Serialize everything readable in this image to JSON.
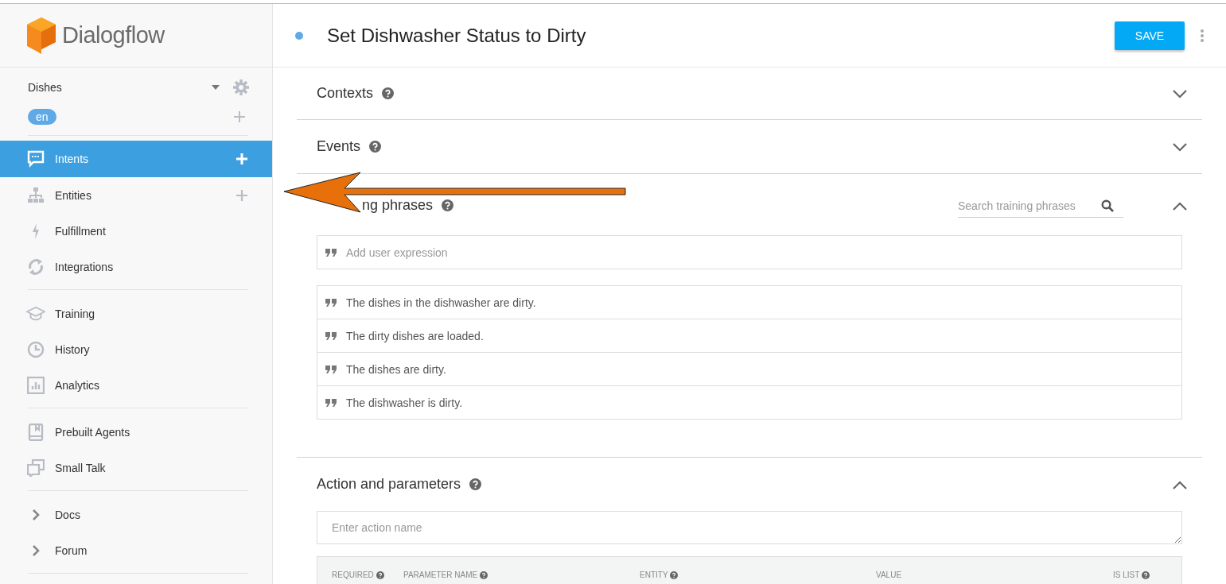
{
  "app": {
    "name": "Dialogflow"
  },
  "agent": {
    "name": "Dishes",
    "language": "en"
  },
  "nav_groups": [
    [
      {
        "label": "Intents",
        "kind": "intents",
        "selected": true,
        "add": true
      },
      {
        "label": "Entities",
        "kind": "entities",
        "selected": false,
        "add": true
      },
      {
        "label": "Fulfillment",
        "kind": "fulfillment",
        "selected": false,
        "add": false
      },
      {
        "label": "Integrations",
        "kind": "integrations",
        "selected": false,
        "add": false
      }
    ],
    [
      {
        "label": "Training",
        "kind": "training",
        "selected": false,
        "add": false
      },
      {
        "label": "History",
        "kind": "history",
        "selected": false,
        "add": false
      },
      {
        "label": "Analytics",
        "kind": "analytics",
        "selected": false,
        "add": false
      }
    ],
    [
      {
        "label": "Prebuilt Agents",
        "kind": "prebuilt",
        "selected": false,
        "add": false
      },
      {
        "label": "Small Talk",
        "kind": "smalltalk",
        "selected": false,
        "add": false
      }
    ],
    [
      {
        "label": "Docs",
        "kind": "link",
        "selected": false,
        "add": false
      },
      {
        "label": "Forum",
        "kind": "link",
        "selected": false,
        "add": false
      }
    ]
  ],
  "intent": {
    "title": "Set Dishwasher Status to Dirty",
    "save": "SAVE"
  },
  "sections": [
    {
      "title": "Contexts",
      "kind": "plain",
      "expanded": false
    },
    {
      "title": "Events",
      "kind": "plain",
      "expanded": false
    },
    {
      "title": "ng phrases",
      "kind": "training",
      "expanded": true,
      "search_placeholder": "Search training phrases",
      "placeholder": "Add user expression",
      "phrases": [
        "The dishes in the dishwasher are dirty.",
        "The dirty dishes are loaded.",
        "The dishes are dirty.",
        "The dishwasher is dirty."
      ]
    },
    {
      "title": "Action and parameters",
      "kind": "action",
      "expanded": true,
      "placeholder": "Enter action name",
      "columns": [
        {
          "label": "REQUIRED",
          "help": true
        },
        {
          "label": "PARAMETER NAME",
          "help": true
        },
        {
          "label": "ENTITY",
          "help": true
        },
        {
          "label": "VALUE",
          "help": false
        },
        {
          "label": "IS LIST",
          "help": true
        }
      ]
    }
  ]
}
